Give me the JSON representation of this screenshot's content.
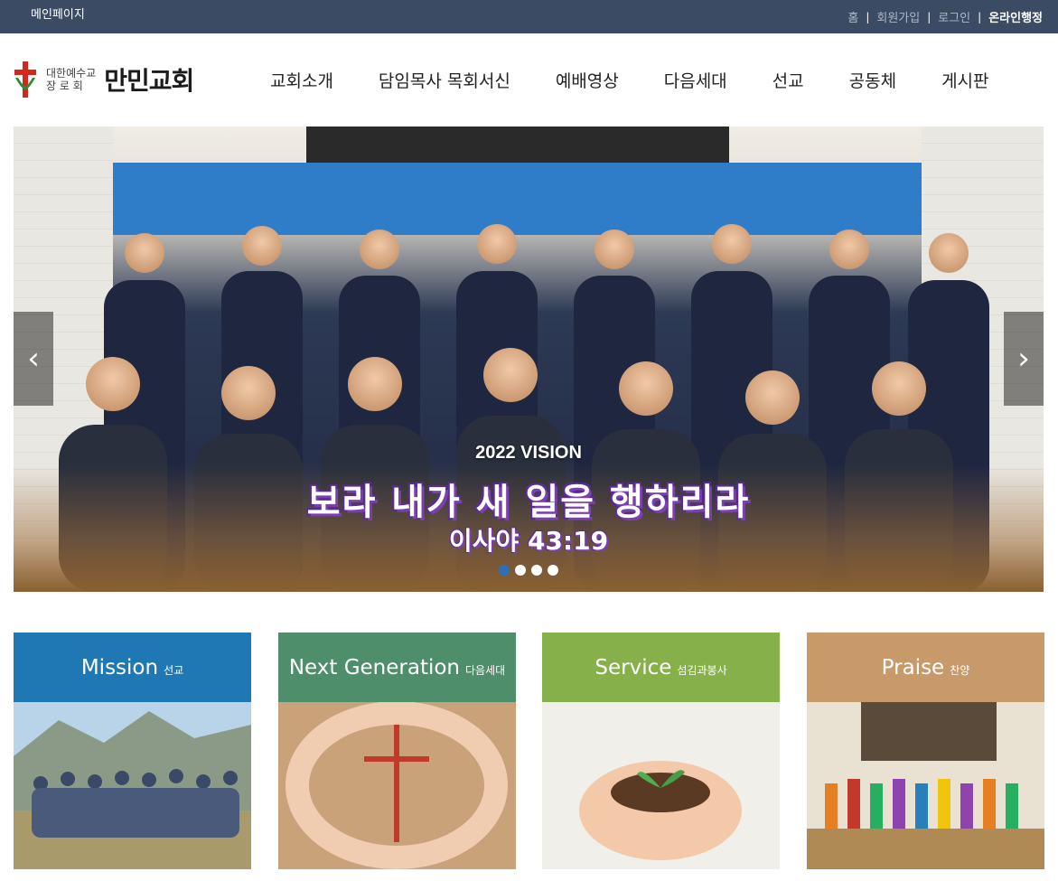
{
  "topbar": {
    "home_page": "메인페이지",
    "links": {
      "home": "홈",
      "signup": "회원가입",
      "login": "로그인",
      "online_admin": "온라인행정"
    },
    "separator": "|"
  },
  "header": {
    "logo": {
      "denomination_line1": "대한예수교",
      "denomination_line2": "장 로 회",
      "church_name": "만민교회",
      "icon": "red-cross-logo-icon"
    },
    "nav": [
      {
        "label": "교회소개"
      },
      {
        "label": "담임목사 목회서신"
      },
      {
        "label": "예배영상"
      },
      {
        "label": "다음세대"
      },
      {
        "label": "선교"
      },
      {
        "label": "공동체"
      },
      {
        "label": "게시판"
      }
    ]
  },
  "hero": {
    "title": "2022 VISION",
    "main_text": "보라 내가 새 일을 행하리라",
    "verse": "이사야 43:19",
    "prev_icon": "chevron-left-icon",
    "next_icon": "chevron-right-icon",
    "slides_count": 4,
    "active_slide": 1
  },
  "cards": [
    {
      "en": "Mission",
      "ko": "선교",
      "color": "#1f78b4"
    },
    {
      "en": "Next Generation",
      "ko": "다음세대",
      "color": "#4e8e6a"
    },
    {
      "en": "Service",
      "ko": "섬김과봉사",
      "color": "#86b04a"
    },
    {
      "en": "Praise",
      "ko": "찬양",
      "color": "#c89a6a"
    }
  ],
  "colors": {
    "topbar_bg": "#3a4b63",
    "dot_active": "#2f6fb3",
    "logo_red": "#d4271e",
    "logo_green": "#2e8a3c"
  }
}
